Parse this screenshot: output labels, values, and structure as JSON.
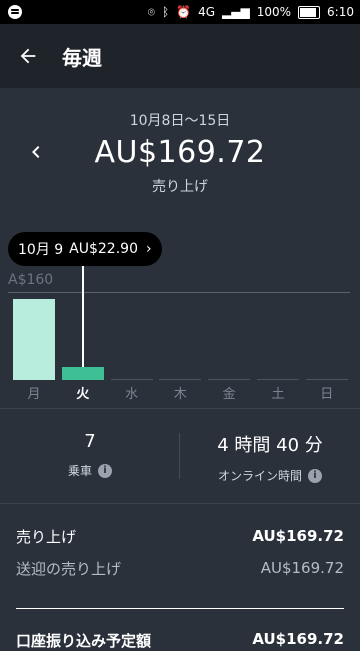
{
  "status_bar": {
    "battery": "100%",
    "time": "6:10",
    "network": "4G"
  },
  "header": {
    "title": "毎週"
  },
  "summary": {
    "date_range": "10月8日〜15日",
    "total": "AU$169.72",
    "total_label": "売り上げ"
  },
  "chart_data": {
    "type": "bar",
    "categories": [
      "月",
      "火",
      "水",
      "木",
      "金",
      "土",
      "日"
    ],
    "values": [
      146.82,
      22.9,
      0,
      0,
      0,
      0,
      0
    ],
    "reference_line_label": "A$160",
    "reference_value": 160,
    "ylim": [
      0,
      160
    ],
    "selected_index": 1,
    "colors": {
      "bar": "#b8ecdc",
      "selected_bar": "#3fbf96",
      "empty": "#4b535d"
    },
    "tooltip": {
      "date": "10月 9",
      "amount": "AU$22.90"
    }
  },
  "stats": {
    "trips_value": "7",
    "trips_label": "乗車",
    "online_value": "4 時間 40 分",
    "online_label": "オンライン時間"
  },
  "earnings": {
    "rows": [
      {
        "label": "売り上げ",
        "value": "AU$169.72"
      },
      {
        "label": "送迎の売り上げ",
        "value": "AU$169.72"
      }
    ],
    "cut_row": {
      "label": "口座振り込み予定額",
      "value": "AU$169.72"
    }
  }
}
